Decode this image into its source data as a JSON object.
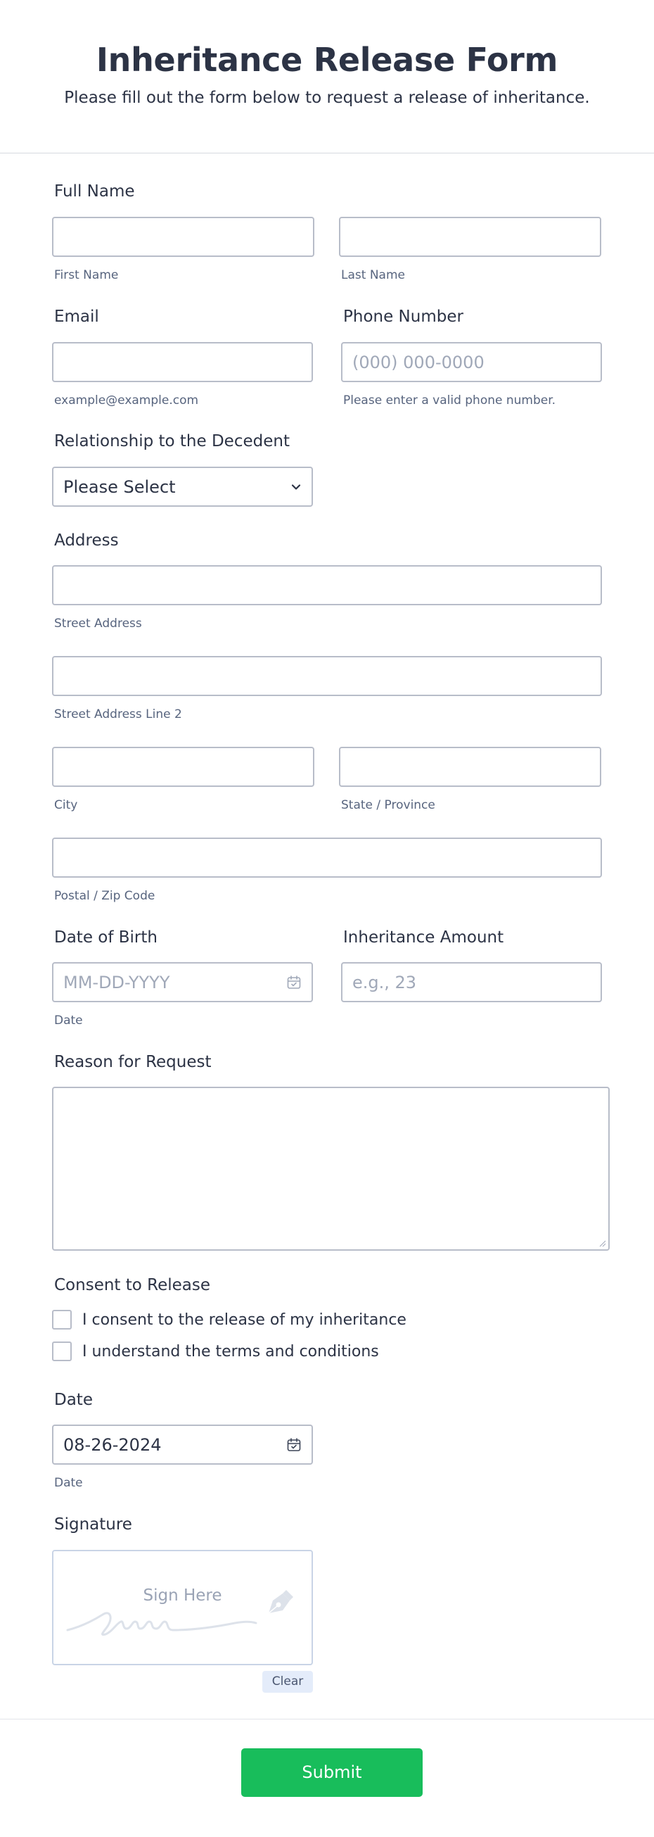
{
  "header": {
    "title": "Inheritance Release Form",
    "subtitle": "Please fill out the form below to request a release of inheritance."
  },
  "full_name": {
    "label": "Full Name",
    "first": {
      "value": "",
      "sublabel": "First Name"
    },
    "last": {
      "value": "",
      "sublabel": "Last Name"
    }
  },
  "email": {
    "label": "Email",
    "value": "",
    "sublabel": "example@example.com"
  },
  "phone": {
    "label": "Phone Number",
    "placeholder": "(000) 000-0000",
    "sublabel": "Please enter a valid phone number."
  },
  "relationship": {
    "label": "Relationship to the Decedent",
    "selected": "Please Select"
  },
  "address": {
    "label": "Address",
    "street": {
      "value": "",
      "sublabel": "Street Address"
    },
    "street2": {
      "value": "",
      "sublabel": "Street Address Line 2"
    },
    "city": {
      "value": "",
      "sublabel": "City"
    },
    "state": {
      "value": "",
      "sublabel": "State / Province"
    },
    "postal": {
      "value": "",
      "sublabel": "Postal / Zip Code"
    }
  },
  "dob": {
    "label": "Date of Birth",
    "placeholder": "MM-DD-YYYY",
    "sublabel": "Date"
  },
  "amount": {
    "label": "Inheritance Amount",
    "placeholder": "e.g., 23"
  },
  "reason": {
    "label": "Reason for Request",
    "value": ""
  },
  "consent": {
    "label": "Consent to Release",
    "options": [
      {
        "label": "I consent to the release of my inheritance",
        "checked": false
      },
      {
        "label": "I understand the terms and conditions",
        "checked": false
      }
    ]
  },
  "date": {
    "label": "Date",
    "value": "08-26-2024",
    "sublabel": "Date"
  },
  "signature": {
    "label": "Signature",
    "hint": "Sign Here",
    "clear_label": "Clear"
  },
  "submit": {
    "label": "Submit"
  },
  "colors": {
    "submit": "#18bd5b",
    "text": "#2c3345",
    "border": "#b8bdc9"
  },
  "icons": {
    "select": "chevron-down-icon",
    "date": "calendar-icon",
    "signature": "pen-nib-icon"
  }
}
